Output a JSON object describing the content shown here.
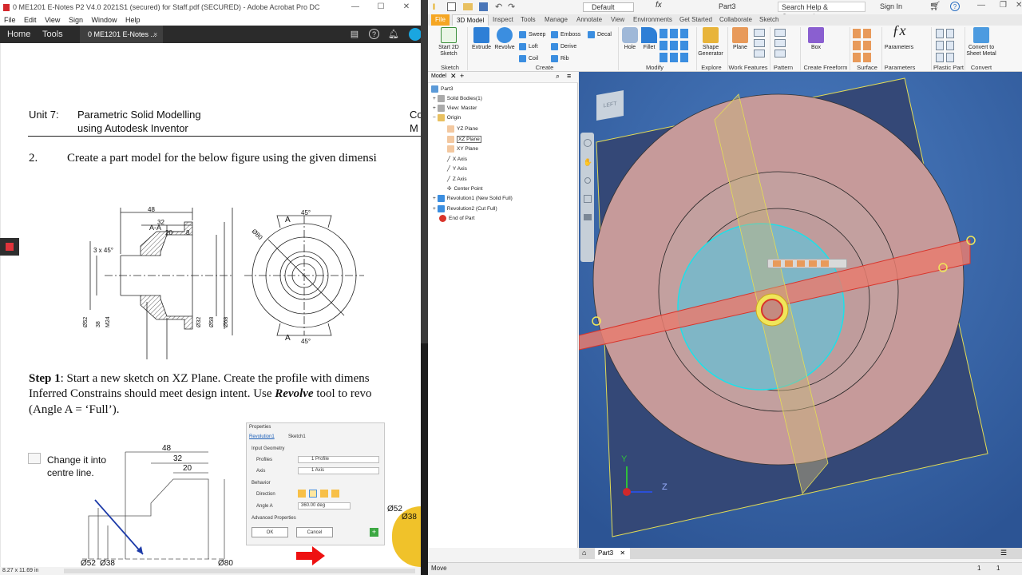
{
  "acrobat": {
    "title": "0 ME1201 E-Notes P2 V4.0 2021S1 (secured) for Staff.pdf (SECURED) - Adobe Acrobat Pro DC",
    "menu": [
      "File",
      "Edit",
      "View",
      "Sign",
      "Window",
      "Help"
    ],
    "nav": {
      "home": "Home",
      "tools": "Tools"
    },
    "doc_tab": "0 ME1201 E-Notes ...",
    "doc_tab_close": "×",
    "header_left_1": "Unit 7:",
    "header_title_1": "Parametric Solid Modelling",
    "header_title_2": "using Autodesk Inventor",
    "header_right_1": "Co",
    "header_right_2": "M",
    "step_num": "2.",
    "step_text": "Create a part model for the below figure using the given dimensi",
    "drawing": {
      "section_label": "A-A",
      "dim_48": "48",
      "dim_32": "32",
      "dim_20": "20",
      "dim_8": "8",
      "chamfer": "3 x 45°",
      "dim_52": "Ø52",
      "dim_38": "38",
      "dim_M24": "M24",
      "dim_32d": "Ø32",
      "dim_58": "Ø58",
      "dim_68": "Ø68",
      "dim_15": "15",
      "dim_28": "28",
      "angle_top": "45°",
      "angle_bot": "45°",
      "dim_80": "Ø80",
      "label_A_top": "A",
      "label_A_bot": "A"
    },
    "step1_bold": "Step 1",
    "step1_line1": ":  Start a new sketch on XZ Plane.  Create the profile with dimens",
    "step1_line2a": "Inferred Constrains should meet design intent.  Use ",
    "step1_revolve": "Revolve",
    "step1_line2b": " tool to revo",
    "step1_line3": "(Angle A = ‘Full’).",
    "callout": "Change it into centre line.",
    "sketch": {
      "d48": "48",
      "d32": "32",
      "d20": "20",
      "d52": "Ø52",
      "d38": "Ø38",
      "d80": "Ø80",
      "d52r": "Ø52",
      "d38r": "Ø38"
    },
    "props": {
      "title": "Properties",
      "tab1": "Revolution1",
      "tab2": "Sketch1",
      "section_input": "Input Geometry",
      "profiles_label": "Profiles",
      "profiles_value": "1 Profile",
      "axis_label": "Axis",
      "axis_value": "1 Axis",
      "section_behavior": "Behavior",
      "direction_label": "Direction",
      "angle_label": "Angle A",
      "angle_value": "360.00 deg",
      "advanced": "Advanced Properties",
      "ok": "OK",
      "cancel": "Cancel"
    },
    "status_size": "8.27 x 11.69 in"
  },
  "inventor": {
    "qat_material": "Default",
    "doc_title": "Part3",
    "search_placeholder": "Search Help & Commands...",
    "sign_in": "Sign In",
    "tabs": [
      "File",
      "3D Model",
      "Inspect",
      "Tools",
      "Manage",
      "Annotate",
      "View",
      "Environments",
      "Get Started",
      "Collaborate",
      "Sketch"
    ],
    "active_tab": "3D Model",
    "ribbon": {
      "start_sketch": "Start 2D Sketch",
      "extrude": "Extrude",
      "revolve": "Revolve",
      "sweep": "Sweep",
      "loft": "Loft",
      "coil": "Coil",
      "emboss": "Emboss",
      "derive": "Derive",
      "rib": "Rib",
      "decal": "Decal",
      "hole": "Hole",
      "fillet": "Fillet",
      "shape_generator": "Shape Generator",
      "plane": "Plane",
      "box": "Box",
      "parameters": "Parameters",
      "convert": "Convert to Sheet Metal",
      "groups": {
        "sketch": "Sketch",
        "create": "Create",
        "modify": "Modify",
        "explore": "Explore",
        "work": "Work Features",
        "pattern": "Pattern",
        "freeform": "Create Freeform",
        "surface": "Surface",
        "params": "Parameters",
        "plastic": "Plastic Part",
        "convert": "Convert"
      }
    },
    "browser": {
      "tab": "Model",
      "nodes": [
        "Part3",
        "Solid Bodies(1)",
        "View: Master",
        "Origin",
        "YZ Plane",
        "XZ Plane",
        "XY Plane",
        "X Axis",
        "Y Axis",
        "Z Axis",
        "Center Point",
        "Revolution1 (New Solid Full)",
        "Revolution2 (Cut Full)",
        "End of Part"
      ]
    },
    "viewcube": "LEFT",
    "axis_y": "Y",
    "axis_z": "Z",
    "doc_tab": "Part3",
    "status": "Move",
    "status_n1": "1",
    "status_n2": "1"
  }
}
